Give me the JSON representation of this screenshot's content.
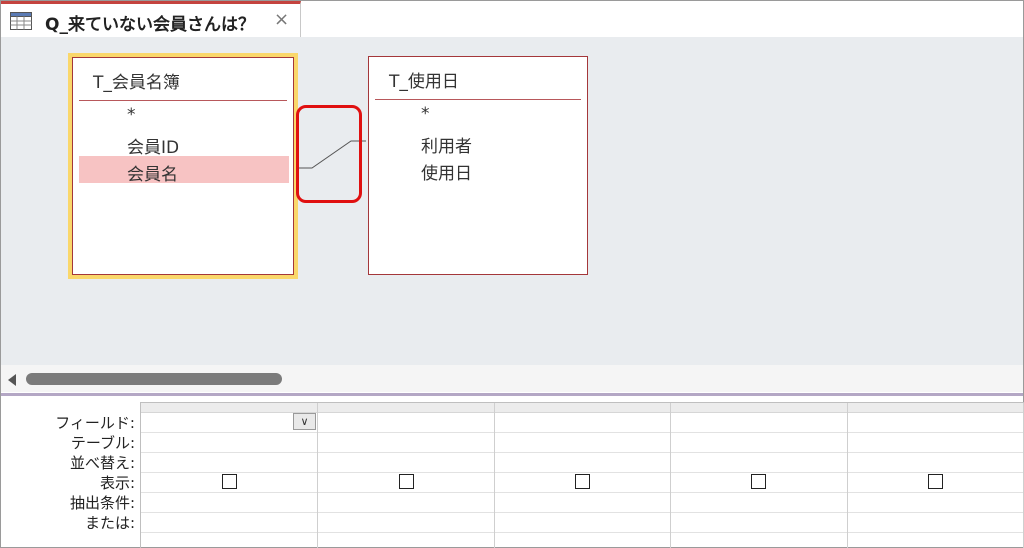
{
  "tab": {
    "title": "Q_来ていない会員さんは？",
    "close_label": "×",
    "icon": "query-icon"
  },
  "tables": [
    {
      "title": "T_会員名簿",
      "fields": [
        "*",
        "会員ID",
        "会員名"
      ],
      "selected_field": "会員名"
    },
    {
      "title": "T_使用日",
      "fields": [
        "*",
        "利用者",
        "使用日"
      ]
    }
  ],
  "grid": {
    "row_labels": [
      "フィールド:",
      "テーブル:",
      "並べ替え:",
      "表示:",
      "抽出条件:",
      "または:"
    ],
    "columns": 5,
    "dropdown_icon": "chevron-down-icon"
  },
  "colors": {
    "tab_accent": "#c4433f",
    "highlight": "#fad76a",
    "callout": "#e01010",
    "selected_row": "#f7c3c3"
  }
}
